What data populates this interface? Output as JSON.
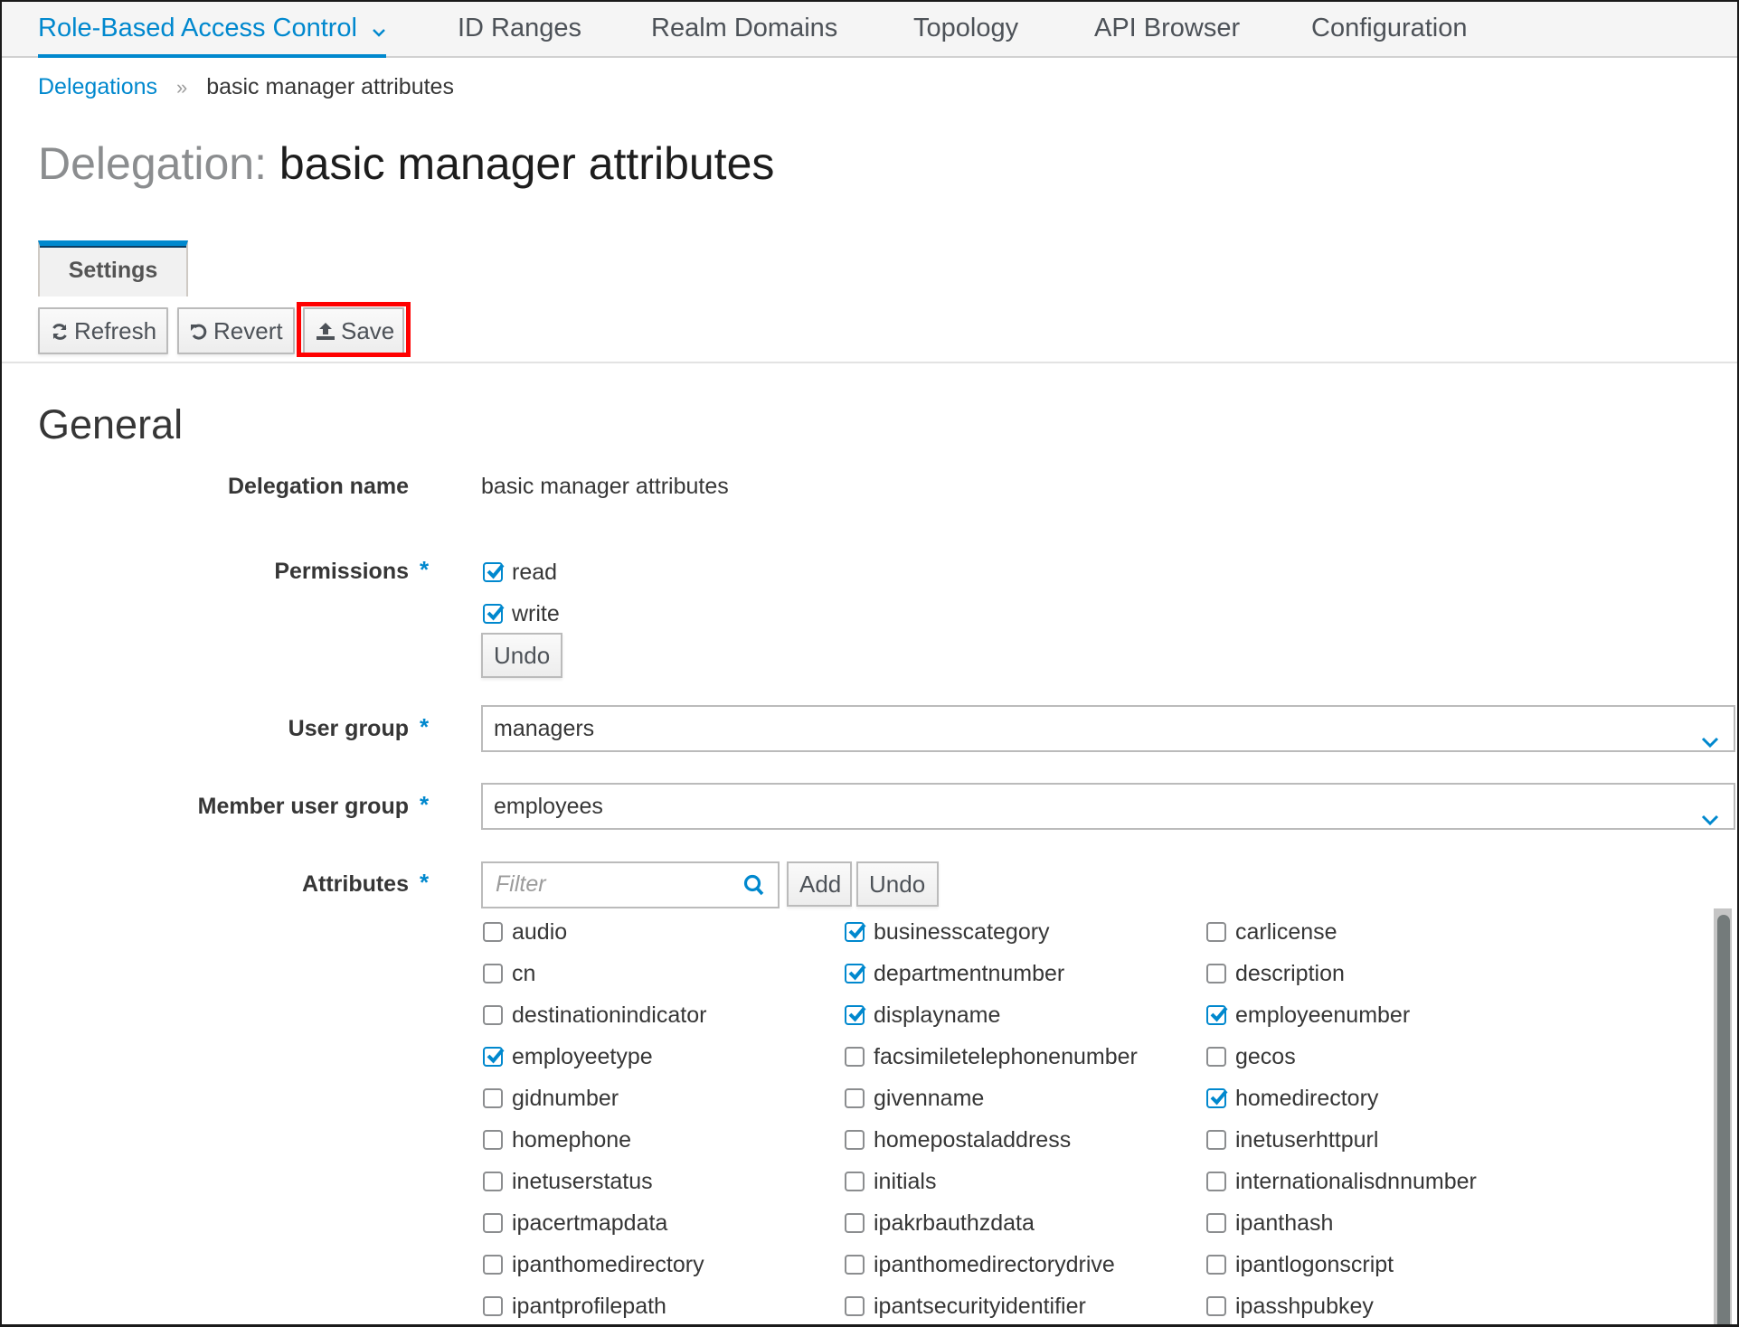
{
  "nav": {
    "items": [
      {
        "label": "Role-Based Access Control",
        "active": true,
        "has_dropdown": true
      },
      {
        "label": "ID Ranges",
        "active": false
      },
      {
        "label": "Realm Domains",
        "active": false
      },
      {
        "label": "Topology",
        "active": false
      },
      {
        "label": "API Browser",
        "active": false
      },
      {
        "label": "Configuration",
        "active": false
      }
    ]
  },
  "breadcrumb": {
    "parent": "Delegations",
    "separator": "»",
    "current": "basic manager attributes"
  },
  "page": {
    "title_prefix": "Delegation:",
    "title_name": "basic manager attributes"
  },
  "tabs": [
    {
      "label": "Settings",
      "active": true
    }
  ],
  "toolbar": {
    "refresh_label": "Refresh",
    "revert_label": "Revert",
    "save_label": "Save",
    "save_highlighted": true
  },
  "general": {
    "section_title": "General",
    "delegation_name_label": "Delegation name",
    "delegation_name_value": "basic manager attributes",
    "permissions_label": "Permissions",
    "required_marker": "*",
    "permissions": [
      {
        "label": "read",
        "checked": true
      },
      {
        "label": "write",
        "checked": true
      }
    ],
    "permissions_undo_label": "Undo",
    "user_group_label": "User group",
    "user_group_value": "managers",
    "member_user_group_label": "Member user group",
    "member_user_group_value": "employees",
    "attributes_label": "Attributes",
    "filter_placeholder": "Filter",
    "filter_value": "",
    "add_label": "Add",
    "attributes_undo_label": "Undo",
    "attributes": [
      {
        "name": "audio",
        "checked": false
      },
      {
        "name": "businesscategory",
        "checked": true
      },
      {
        "name": "carlicense",
        "checked": false
      },
      {
        "name": "cn",
        "checked": false
      },
      {
        "name": "departmentnumber",
        "checked": true
      },
      {
        "name": "description",
        "checked": false
      },
      {
        "name": "destinationindicator",
        "checked": false
      },
      {
        "name": "displayname",
        "checked": true
      },
      {
        "name": "employeenumber",
        "checked": true
      },
      {
        "name": "employeetype",
        "checked": true
      },
      {
        "name": "facsimiletelephonenumber",
        "checked": false
      },
      {
        "name": "gecos",
        "checked": false
      },
      {
        "name": "gidnumber",
        "checked": false
      },
      {
        "name": "givenname",
        "checked": false
      },
      {
        "name": "homedirectory",
        "checked": true
      },
      {
        "name": "homephone",
        "checked": false
      },
      {
        "name": "homepostaladdress",
        "checked": false
      },
      {
        "name": "inetuserhttpurl",
        "checked": false
      },
      {
        "name": "inetuserstatus",
        "checked": false
      },
      {
        "name": "initials",
        "checked": false
      },
      {
        "name": "internationalisdnnumber",
        "checked": false
      },
      {
        "name": "ipacertmapdata",
        "checked": false
      },
      {
        "name": "ipakrbauthzdata",
        "checked": false
      },
      {
        "name": "ipanthash",
        "checked": false
      },
      {
        "name": "ipanthomedirectory",
        "checked": false
      },
      {
        "name": "ipanthomedirectorydrive",
        "checked": false
      },
      {
        "name": "ipantlogonscript",
        "checked": false
      },
      {
        "name": "ipantprofilepath",
        "checked": false
      },
      {
        "name": "ipantsecurityidentifier",
        "checked": false
      },
      {
        "name": "ipasshpubkey",
        "checked": false
      }
    ]
  },
  "colors": {
    "accent": "#0088ce",
    "highlight": "#ff0000",
    "nav_bg": "#f5f5f5"
  },
  "icons": {
    "refresh": "refresh-icon",
    "revert": "undo-icon",
    "save": "upload-icon",
    "search": "search-icon",
    "dropdown": "chevron-down-icon",
    "checkbox_checked": "checkmark-icon"
  }
}
